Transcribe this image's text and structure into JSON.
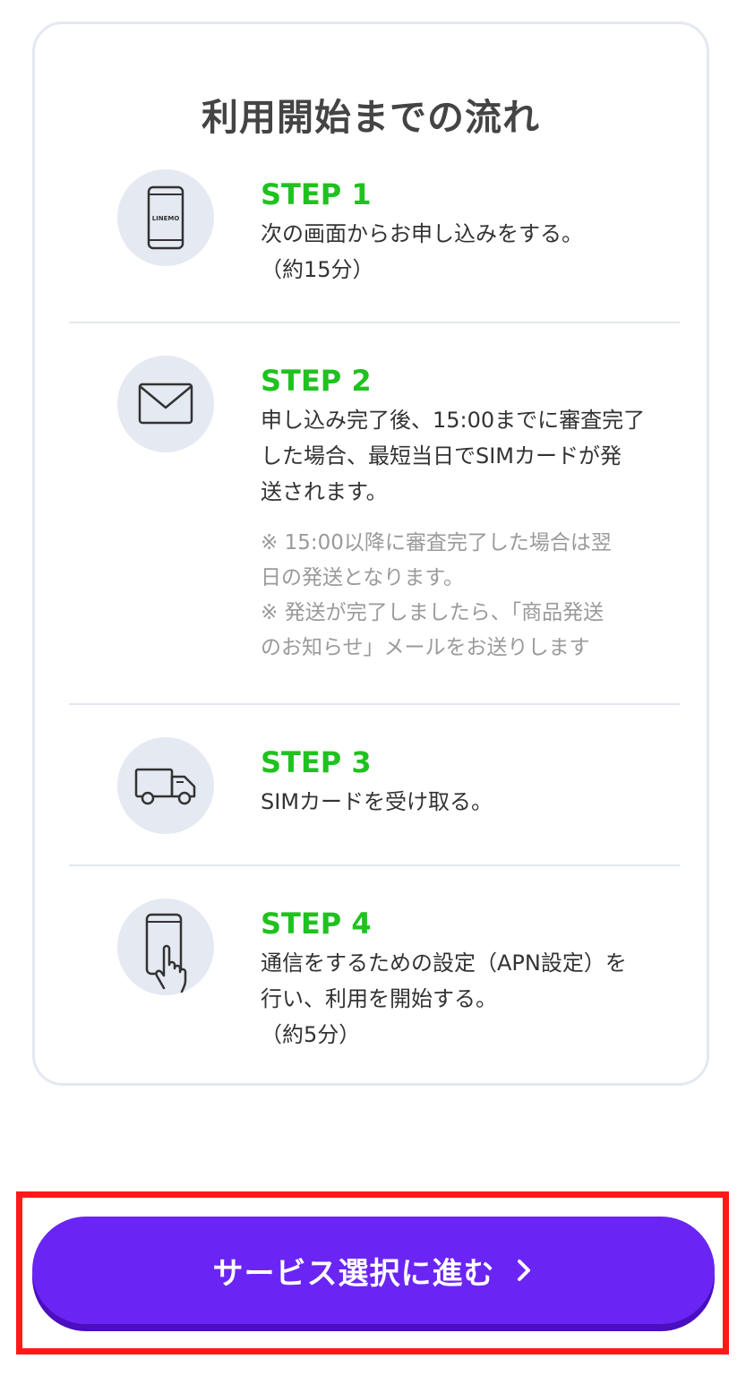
{
  "flow": {
    "title": "利用開始までの流れ",
    "steps": [
      {
        "label": "STEP 1",
        "icon": "smartphone-linemo-icon",
        "icon_text": "LINEMO",
        "description": "次の画面からお申し込みをする。\n（約15分）"
      },
      {
        "label": "STEP 2",
        "icon": "envelope-icon",
        "description": "申し込み完了後、15:00までに審査完了\nした場合、最短当日でSIMカードが発\n送されます。",
        "note": "※ 15:00以降に審査完了した場合は翌\n日の発送となります。\n※ 発送が完了しましたら、「商品発送\nのお知らせ」メールをお送りします"
      },
      {
        "label": "STEP 3",
        "icon": "delivery-truck-icon",
        "description": "SIMカードを受け取る。"
      },
      {
        "label": "STEP 4",
        "icon": "phone-tap-hand-icon",
        "description": "通信をするための設定（APN設定）を\n行い、利用を開始する。\n（約5分）"
      }
    ]
  },
  "cta": {
    "label": "サービス選択に進む",
    "icon": "chevron-right-icon"
  },
  "colors": {
    "step_label": "#1fc21f",
    "cta_background": "#6a25f4",
    "highlight_outline": "#ff1a1a",
    "icon_circle": "#e4e9f2"
  }
}
